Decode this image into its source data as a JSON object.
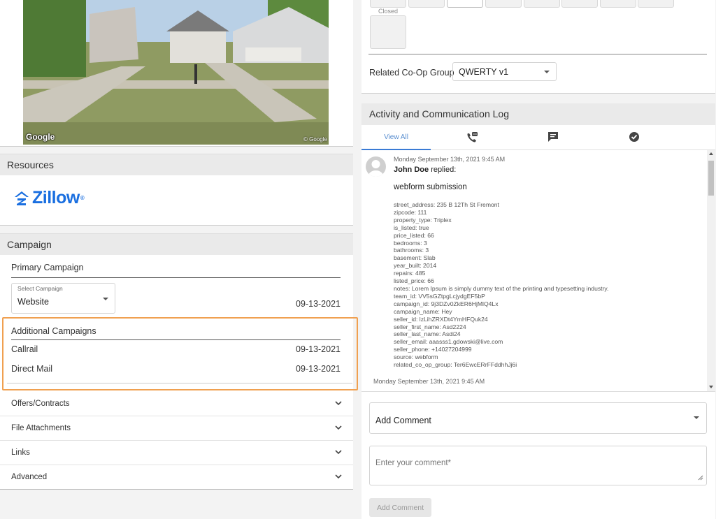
{
  "street_view": {
    "google_label": "Google",
    "copyright": "© Google"
  },
  "resources": {
    "title": "Resources",
    "zillow_label": "Zillow",
    "zillow_tm": "®"
  },
  "campaign": {
    "title": "Campaign",
    "primary_title": "Primary Campaign",
    "select_label": "Select Campaign",
    "select_value": "Website",
    "primary_date": "09-13-2021",
    "additional_title": "Additional Campaigns",
    "additional": [
      {
        "name": "Callrail",
        "date": "09-13-2021"
      },
      {
        "name": "Direct Mail",
        "date": "09-13-2021"
      }
    ]
  },
  "accordion": [
    {
      "label": "Offers/Contracts"
    },
    {
      "label": "File Attachments"
    },
    {
      "label": "Links"
    },
    {
      "label": "Advanced"
    }
  ],
  "status": {
    "closed_label": "Closed",
    "coop_label": "Related Co-Op Group",
    "coop_value": "QWERTY v1"
  },
  "activity": {
    "title": "Activity and Communication Log",
    "tab_view_all": "View All",
    "entry": {
      "date": "Monday September 13th, 2021 9:45 AM",
      "user": "John Doe",
      "action": "replied:",
      "subject": "webform submission",
      "fields": [
        "street_address: 235 B 12Th St Fremont",
        "zipcode: 111",
        "property_type: Triplex",
        "is_listed: true",
        "price_listed: 66",
        "bedrooms: 3",
        "bathrooms: 3",
        "basement: Slab",
        "year_built: 2014",
        "repairs: 485",
        "listed_price: 66",
        "notes: Lorem Ipsum is simply dummy text of the printing and typesetting industry.",
        "team_id: VV5sGZtpgLcjydgEF5bP",
        "campaign_id: 9j3DZv0ZkER6HjMlQ4Lx",
        "campaign_name: Hey",
        "seller_id: lzLihZRXDt4YmHFQuk24",
        "seller_first_name: Asd2224",
        "seller_last_name: Asdi24",
        "seller_email: aaasss1.gdowski@live.com",
        "seller_phone: +14027204999",
        "source: webform",
        "related_co_op_group: Ter6EwcERrFFddhhJj6i"
      ]
    },
    "next_date": "Monday September 13th, 2021 9:45 AM"
  },
  "comment": {
    "select_label": "Add Comment",
    "placeholder": "Enter your comment*",
    "button_label": "Add Comment"
  },
  "colors": {
    "accent": "#3a7bd5",
    "highlight_border": "#f0a050",
    "zillow_blue": "#1a6fe0"
  }
}
